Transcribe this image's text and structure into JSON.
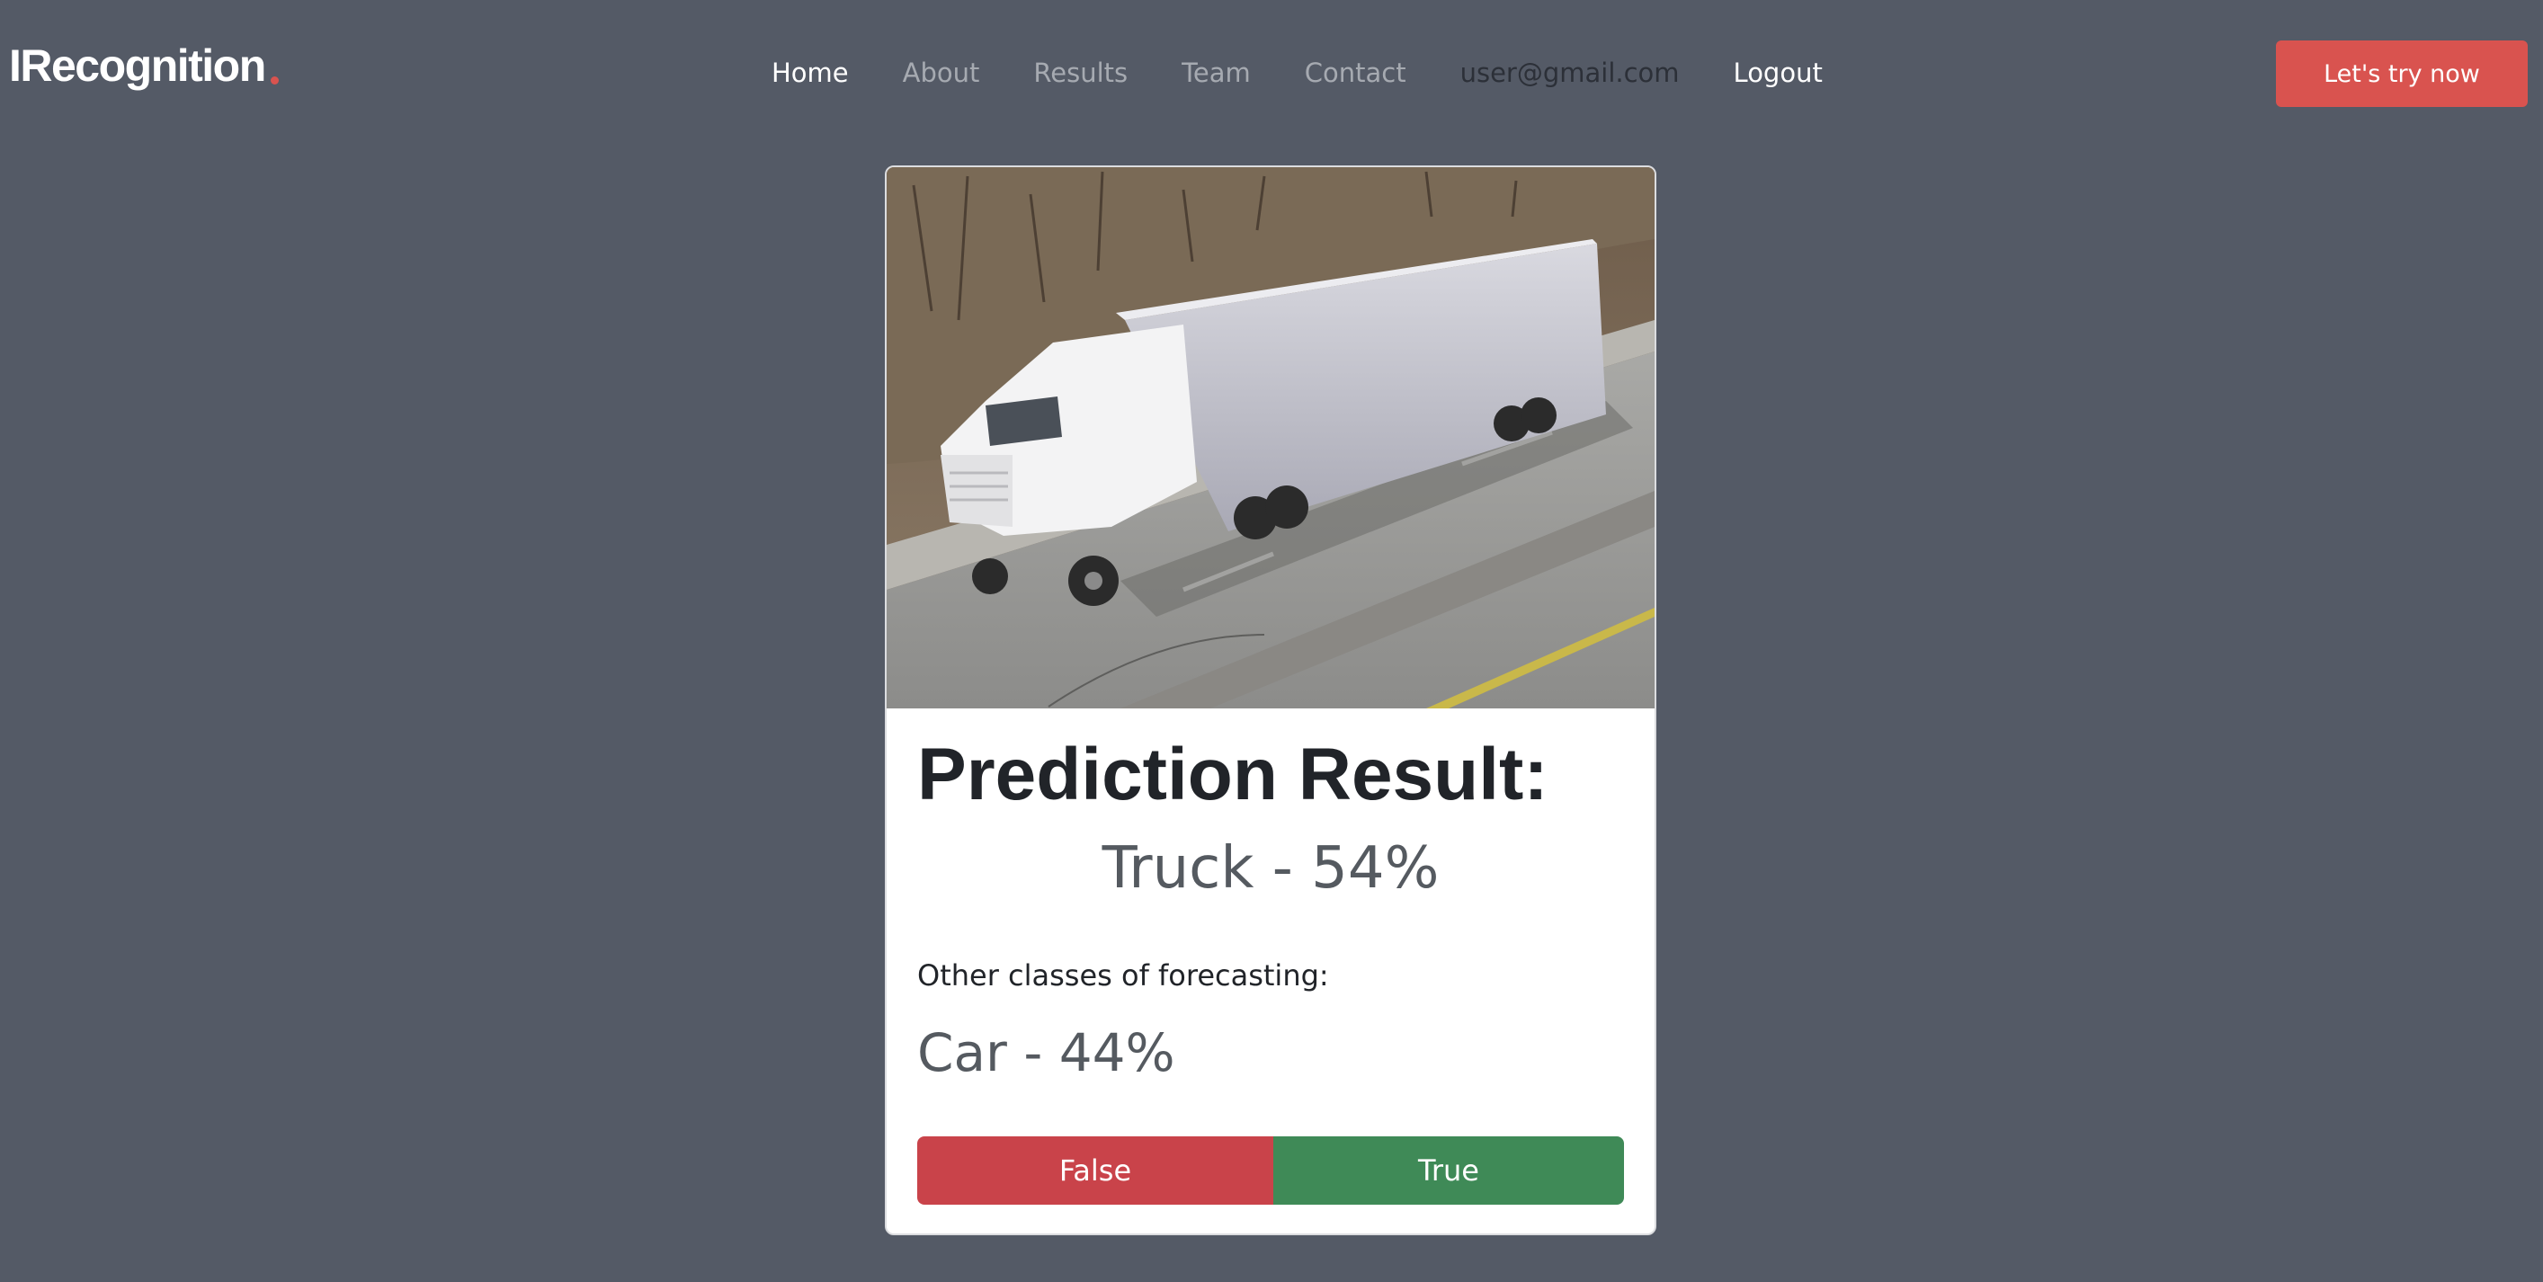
{
  "brand": {
    "name": "IRecognition",
    "accent_color": "#d9534f"
  },
  "nav": {
    "items": [
      {
        "label": "Home",
        "state": "active"
      },
      {
        "label": "About",
        "state": "inactive"
      },
      {
        "label": "Results",
        "state": "inactive"
      },
      {
        "label": "Team",
        "state": "inactive"
      },
      {
        "label": "Contact",
        "state": "inactive"
      },
      {
        "label": "user@gmail.com",
        "state": "user"
      },
      {
        "label": "Logout",
        "state": "active"
      }
    ],
    "cta_label": "Let's try now"
  },
  "card": {
    "image_subject": "truck-photo",
    "title": "Prediction Result:",
    "main_prediction": "Truck - 54%",
    "other_label": "Other classes of forecasting:",
    "other_predictions": [
      "Car - 44%"
    ],
    "false_label": "False",
    "true_label": "True"
  },
  "colors": {
    "background": "#545a66",
    "false_button": "#c9434a",
    "true_button": "#3f8a57",
    "cta_button": "#d9534f"
  }
}
